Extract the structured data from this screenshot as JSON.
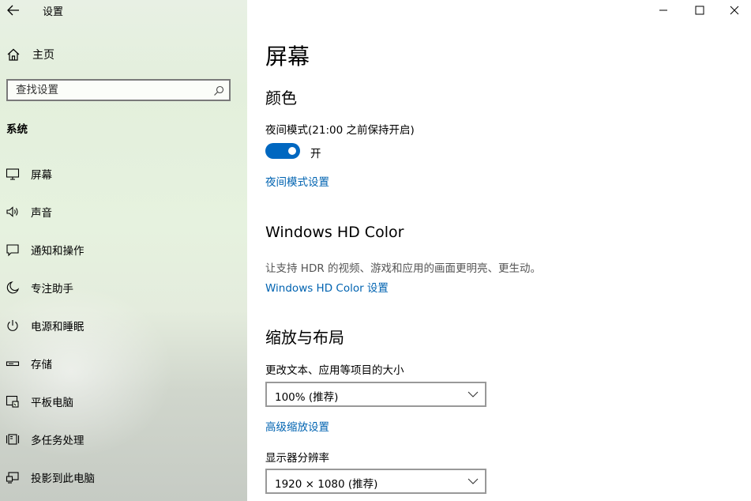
{
  "app": {
    "title": "设置"
  },
  "sidebar": {
    "home_label": "主页",
    "search_placeholder": "查找设置",
    "section_label": "系统",
    "items": [
      {
        "label": "屏幕",
        "icon": "monitor-icon"
      },
      {
        "label": "声音",
        "icon": "speaker-icon"
      },
      {
        "label": "通知和操作",
        "icon": "notification-icon"
      },
      {
        "label": "专注助手",
        "icon": "moon-icon"
      },
      {
        "label": "电源和睡眠",
        "icon": "power-icon"
      },
      {
        "label": "存储",
        "icon": "storage-icon"
      },
      {
        "label": "平板电脑",
        "icon": "tablet-icon"
      },
      {
        "label": "多任务处理",
        "icon": "multitask-icon"
      },
      {
        "label": "投影到此电脑",
        "icon": "project-icon"
      }
    ]
  },
  "main": {
    "page_title": "屏幕",
    "color": {
      "heading": "颜色",
      "night_light_label": "夜间模式(21:00 之前保持开启)",
      "toggle_state": "开",
      "toggle_on": true,
      "settings_link": "夜间模式设置"
    },
    "hdr": {
      "heading": "Windows HD Color",
      "description": "让支持 HDR 的视频、游戏和应用的画面更明亮、更生动。",
      "settings_link": "Windows HD Color 设置"
    },
    "scale": {
      "heading": "缩放与布局",
      "size_label": "更改文本、应用等项目的大小",
      "size_value": "100% (推荐)",
      "advanced_link": "高级缩放设置",
      "resolution_label": "显示器分辨率",
      "resolution_value": "1920 × 1080 (推荐)"
    }
  },
  "colors": {
    "accent": "#0067c0",
    "link": "#0063b1"
  }
}
